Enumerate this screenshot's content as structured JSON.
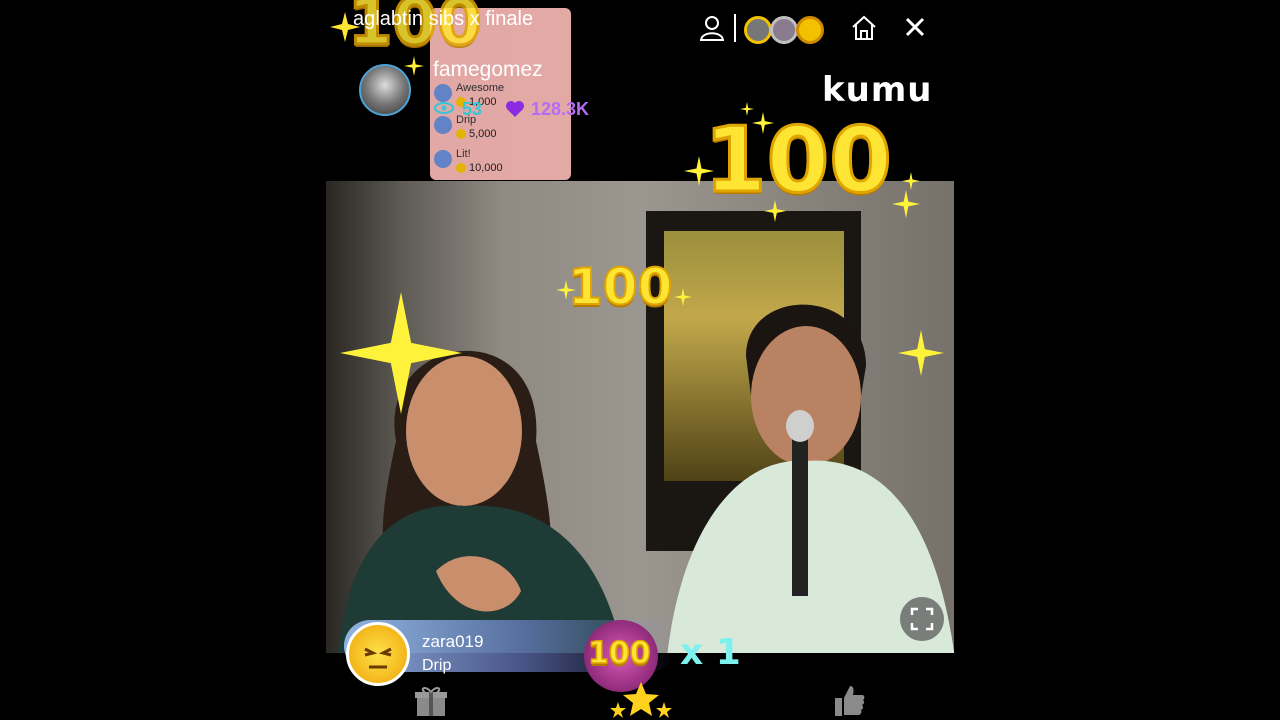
{
  "stream": {
    "title": "aglabtin sibs x finale",
    "host_name": "famegomez",
    "viewer_count": "53",
    "heart_count": "128.3K",
    "brand": "kumu"
  },
  "gift_menu": {
    "items": [
      {
        "label": "Awesome",
        "price": "1,000"
      },
      {
        "label": "Drip",
        "price": "5,000"
      },
      {
        "label": "Lit!",
        "price": "10,000"
      }
    ]
  },
  "overlays": {
    "big_number_top": "100",
    "big_number_right": "100",
    "big_number_mid": "100",
    "badge_number": "100"
  },
  "comment": {
    "username": "zara019",
    "gift_name": "Drip",
    "combo": "x 1"
  },
  "icons": {
    "profile": "profile-icon",
    "home": "home-icon",
    "close": "close-icon",
    "fullscreen": "fullscreen-icon",
    "gift": "gift-icon",
    "star": "star-icon",
    "like": "thumbs-up-icon"
  },
  "colors": {
    "accent_yellow": "#ffe533",
    "viewer_cyan": "#35c6d6",
    "heart_purple": "#b46cf5"
  }
}
